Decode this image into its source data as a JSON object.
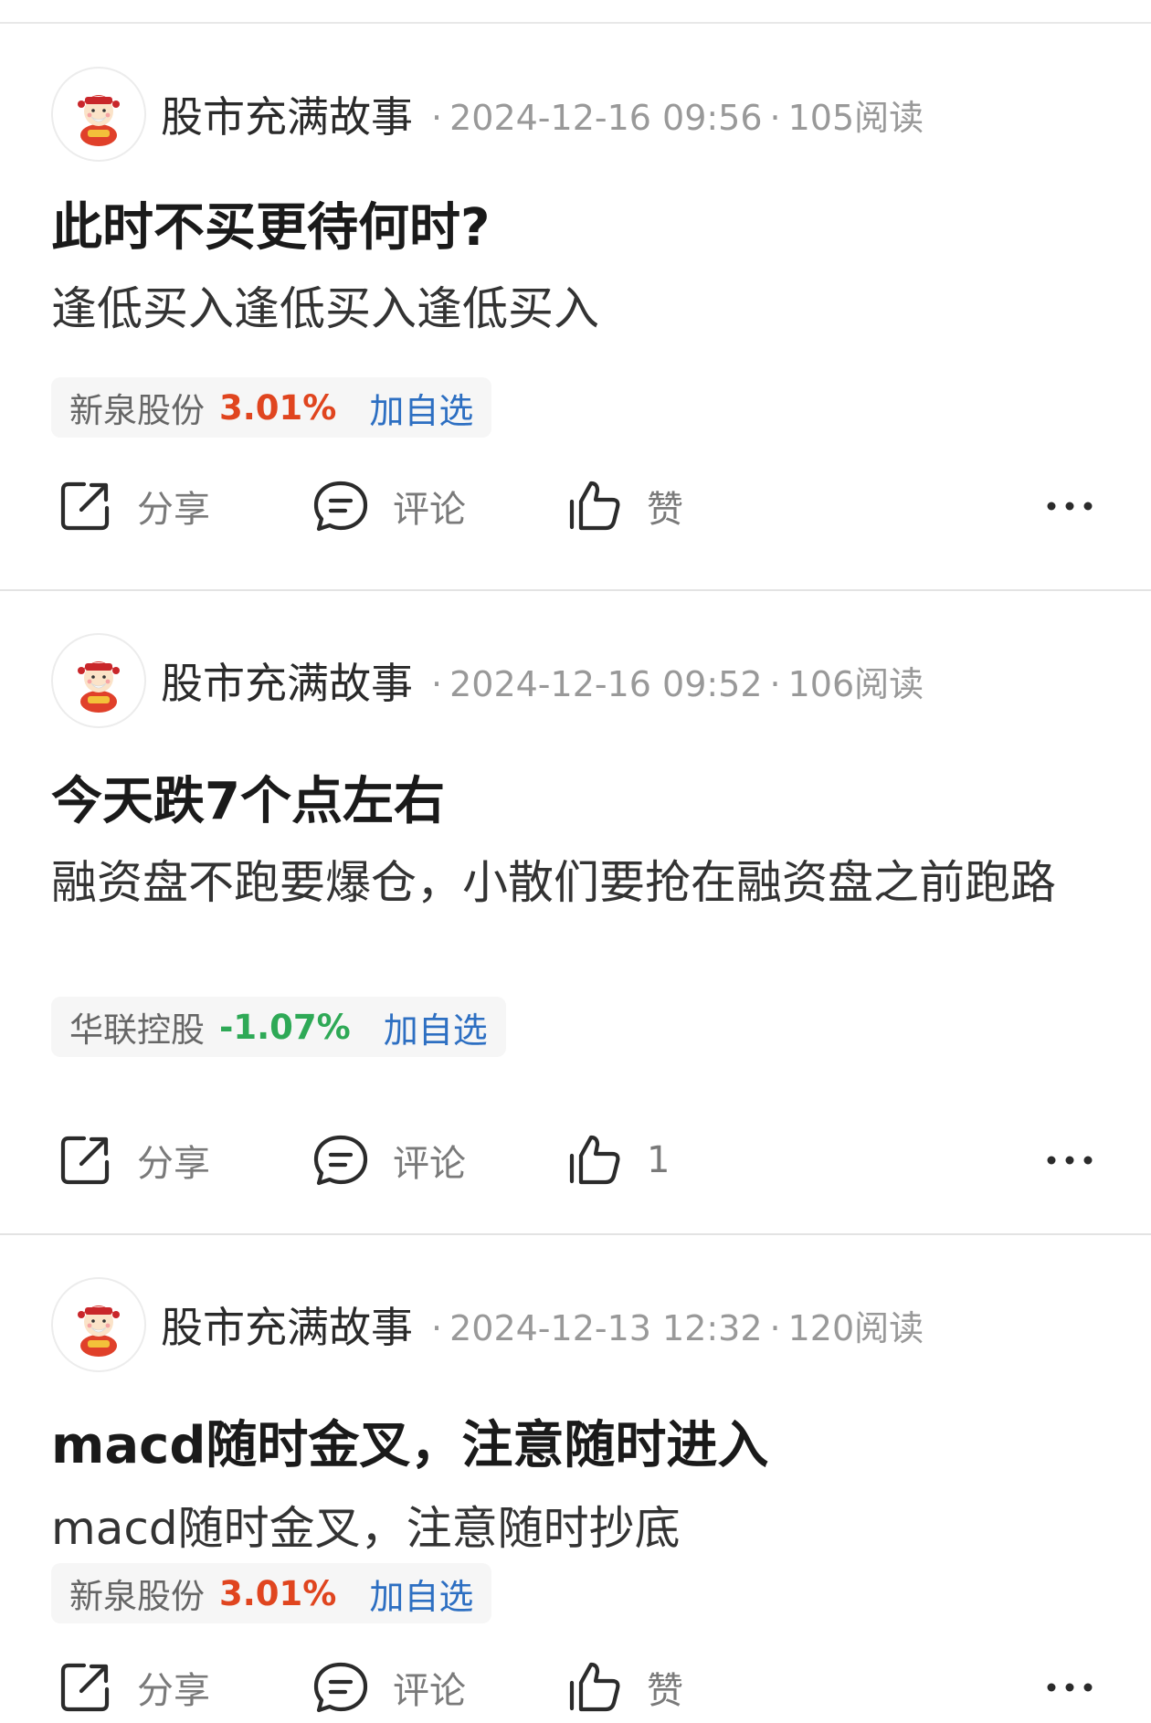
{
  "feed": {
    "action_labels": {
      "share": "分享",
      "comment": "评论"
    },
    "posts": [
      {
        "author": "股市充满故事",
        "timestamp": "2024-12-16 09:56",
        "reads": "105阅读",
        "title": "此时不买更待何时?",
        "body": "逢低买入逢低买入逢低买入",
        "stock": {
          "name": "新泉股份",
          "change": "3.01%",
          "direction": "up",
          "add_label": "加自选"
        },
        "like_label": "赞"
      },
      {
        "author": "股市充满故事",
        "timestamp": "2024-12-16 09:52",
        "reads": "106阅读",
        "title": "今天跌7个点左右",
        "body": "融资盘不跑要爆仓，小散们要抢在融资盘之前跑路",
        "stock": {
          "name": "华联控股",
          "change": "-1.07%",
          "direction": "down",
          "add_label": "加自选"
        },
        "like_label": "1"
      },
      {
        "author": "股市充满故事",
        "timestamp": "2024-12-13 12:32",
        "reads": "120阅读",
        "title": "macd随时金叉，注意随时进入",
        "body": "macd随时金叉，注意随时抄底",
        "stock": {
          "name": "新泉股份",
          "change": "3.01%",
          "direction": "up",
          "add_label": "加自选"
        },
        "like_label": "赞"
      }
    ]
  },
  "colors": {
    "stock_up": "#e0451f",
    "stock_down": "#2ea956",
    "link_blue": "#2d6fc2",
    "meta_gray": "#999999"
  },
  "icons": {
    "avatar": "cartoon-fortune-god-avatar",
    "share": "share-out-icon",
    "comment": "comment-bubble-icon",
    "like": "thumbs-up-icon",
    "more": "more-dots-icon"
  }
}
